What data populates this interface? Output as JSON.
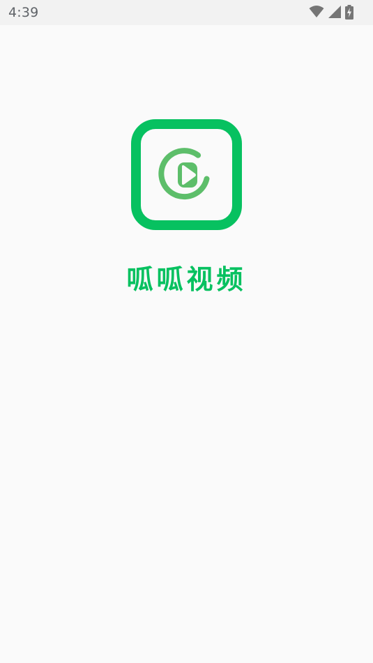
{
  "status_bar": {
    "time": "4:39",
    "icons": [
      "wifi-icon",
      "cellular-signal-icon",
      "battery-charging-icon"
    ]
  },
  "splash": {
    "app_name": "呱呱视频",
    "logo_icon": "play-circle-icon"
  },
  "colors": {
    "brand_green": "#07c160",
    "play_green": "#5dbe6a",
    "status_bar_bg": "#f2f2f2",
    "background": "#fafafa",
    "status_icon": "#757575"
  }
}
